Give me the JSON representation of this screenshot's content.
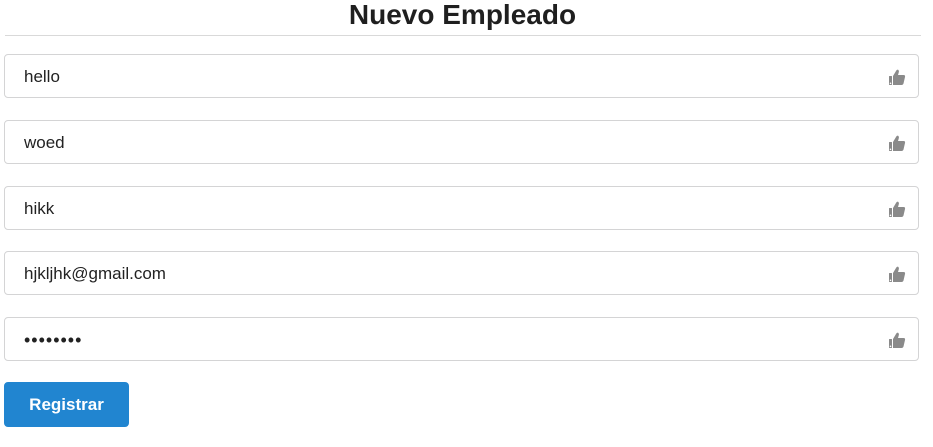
{
  "page": {
    "title": "Nuevo Empleado"
  },
  "form": {
    "fields": [
      {
        "value": "hello",
        "icon": "thumbs-up-icon"
      },
      {
        "value": "woed",
        "icon": "thumbs-up-icon"
      },
      {
        "value": "hikk",
        "icon": "thumbs-up-icon"
      },
      {
        "value": "hjkljhk@gmail.com",
        "icon": "thumbs-up-icon"
      },
      {
        "value": "••••••••",
        "icon": "thumbs-up-icon"
      }
    ],
    "submit_label": "Registrar"
  },
  "colors": {
    "primary_button": "#2185d0",
    "field_border": "#d4d4d5",
    "icon_gray": "#8a8a8a"
  }
}
